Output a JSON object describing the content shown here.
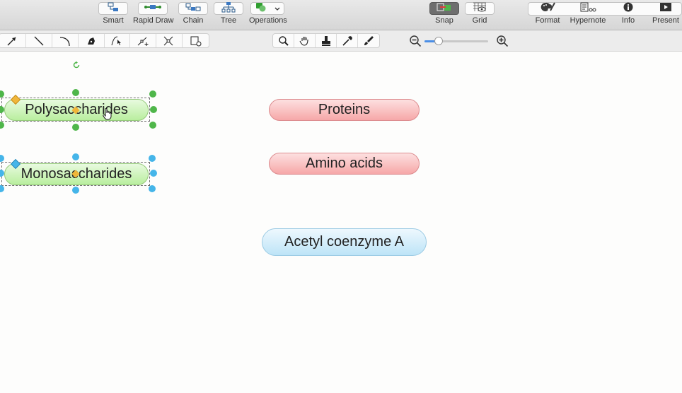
{
  "toolbar": {
    "left": [
      {
        "label": "Smart",
        "icon": "smart-icon"
      },
      {
        "label": "Rapid Draw",
        "icon": "rapid-draw-icon"
      },
      {
        "label": "Chain",
        "icon": "chain-icon"
      },
      {
        "label": "Tree",
        "icon": "tree-icon"
      },
      {
        "label": "Operations",
        "icon": "operations-icon"
      }
    ],
    "middle": [
      {
        "label": "Snap",
        "icon": "snap-icon",
        "active": true
      },
      {
        "label": "Grid",
        "icon": "grid-icon"
      }
    ],
    "right": [
      {
        "label": "Format",
        "icon": "format-icon"
      },
      {
        "label": "Hypernote",
        "icon": "hypernote-icon"
      },
      {
        "label": "Info",
        "icon": "info-icon"
      },
      {
        "label": "Present",
        "icon": "present-icon"
      }
    ]
  },
  "drawing_tools": [
    "arrow-tool-icon",
    "line-tool-icon",
    "arc-tool-icon",
    "pen-tool-icon",
    "bezier-select-icon",
    "add-point-icon",
    "split-icon",
    "insert-shape-icon"
  ],
  "view_tools": [
    "magnifier-icon",
    "hand-icon",
    "stamp-icon",
    "eyedropper-icon",
    "brush-icon"
  ],
  "zoom": {
    "level": 0.22
  },
  "canvas": {
    "nodes": [
      {
        "id": "polysaccharides",
        "label": "Polysaccharides",
        "color": "green",
        "selected": true
      },
      {
        "id": "monosaccharides",
        "label": "Monosaccharides",
        "color": "green",
        "selected": true
      },
      {
        "id": "proteins",
        "label": "Proteins",
        "color": "red"
      },
      {
        "id": "amino-acids",
        "label": "Amino acids",
        "color": "red"
      },
      {
        "id": "acetyl-coa",
        "label": "Acetyl coenzyme A",
        "color": "blue"
      }
    ]
  },
  "colors": {
    "accent": "#4a8ee6",
    "green_handle": "#4fb64a",
    "blue_handle": "#45b5e9",
    "diamond_orange": "#f0b63a"
  }
}
